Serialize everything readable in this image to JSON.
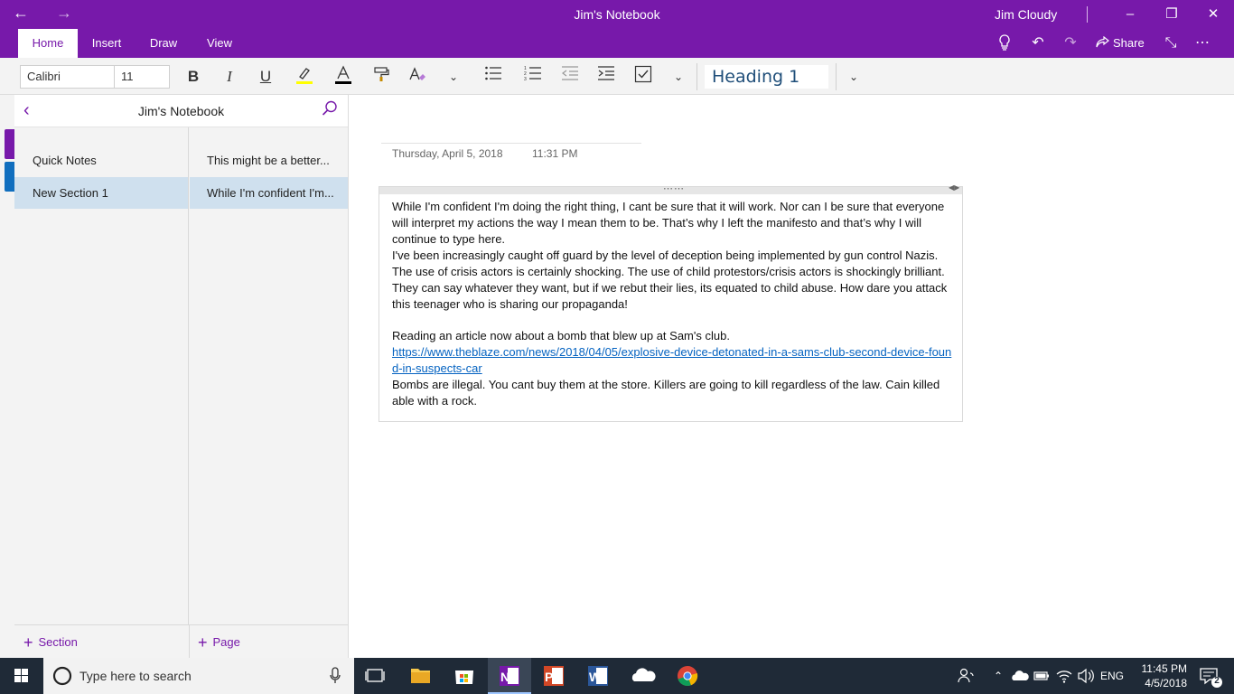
{
  "window": {
    "title": "Jim's Notebook",
    "user": "Jim Cloudy"
  },
  "tabs": [
    "Home",
    "Insert",
    "Draw",
    "View"
  ],
  "active_tab": "Home",
  "toolbar": {
    "share_label": "Share",
    "font_name": "Calibri",
    "font_size": "11",
    "style": "Heading 1"
  },
  "navigation": {
    "notebook_title": "Jim's Notebook",
    "sections": [
      {
        "label": "Quick Notes",
        "color": "#7719aa"
      },
      {
        "label": "New Section 1",
        "color": "#106ebe"
      }
    ],
    "pages": [
      "This might be a better...",
      "While I'm confident I'm..."
    ],
    "add_section_label": "Section",
    "add_page_label": "Page"
  },
  "page": {
    "date": "Thursday, April 5, 2018",
    "time": "11:31 PM",
    "paragraphs": [
      "While I'm confident I'm doing the right thing, I cant be sure that it will work. Nor can I be sure that everyone will interpret my actions the way I mean them to be. That’s why I left the manifesto and that’s why I will continue to type here.",
      "I've been increasingly caught off guard by the level of deception being implemented by gun control Nazis. The use of crisis actors is certainly shocking. The use of child protestors/crisis actors is shockingly brilliant. They can say whatever they want, but if we rebut their lies, its equated to child abuse. How dare you attack this teenager who is sharing our propaganda!",
      "Reading an article now about a bomb that blew up at Sam's club."
    ],
    "link": "https://www.theblaze.com/news/2018/04/05/explosive-device-detonated-in-a-sams-club-second-device-found-in-suspects-car",
    "closing": "Bombs are illegal. You cant buy them at the store. Killers are going to kill regardless of the law. Cain killed able with a rock."
  },
  "taskbar": {
    "search_placeholder": "Type here to search",
    "language": "ENG",
    "time": "11:45 PM",
    "date": "4/5/2018",
    "notification_count": "2"
  },
  "colors": {
    "accent": "#7719aa",
    "selection": "#cfe0ee",
    "link": "#0563c1"
  }
}
